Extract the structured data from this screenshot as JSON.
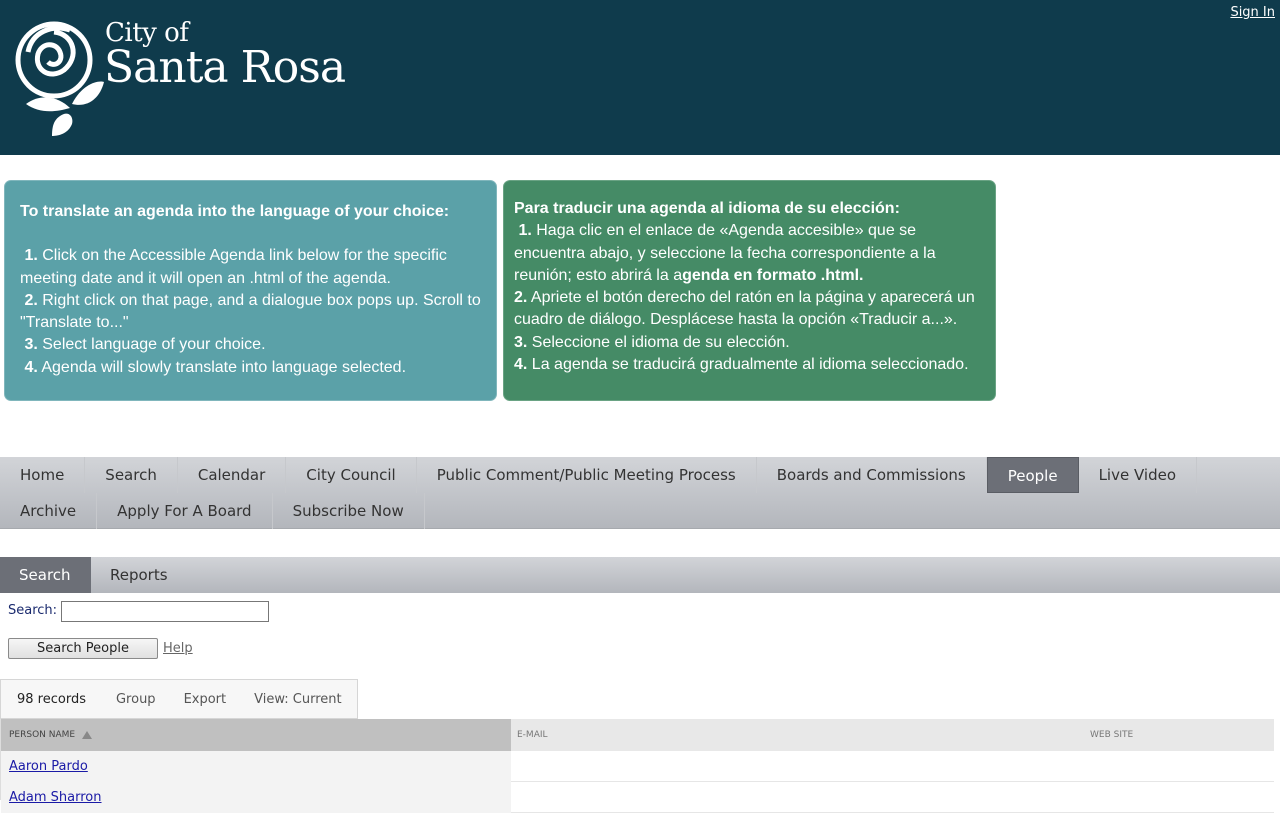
{
  "header": {
    "logo_city": "City of",
    "logo_name": "Santa Rosa",
    "sign_in": "Sign In"
  },
  "panel_en": {
    "title": "To translate an agenda into the language of your choice:",
    "steps": [
      {
        "num": "1.",
        "text": "Click on the Accessible Agenda link below for the specific meeting date and it will open an .html of the agenda."
      },
      {
        "num": "2.",
        "text": "Right click on that page, and a dialogue box pops up. Scroll to \"Translate to...\""
      },
      {
        "num": "3.",
        "text": "Select language of your choice."
      },
      {
        "num": "4.",
        "text": "Agenda will slowly translate into language selected."
      }
    ]
  },
  "panel_es": {
    "title": "Para traducir una agenda al idioma de su elección:",
    "steps": [
      {
        "num": "1.",
        "text": "Haga clic en el enlace de «Agenda accesible» que se encuentra abajo, y seleccione la fecha correspondiente a la reunión; esto abrirá la a",
        "bold_tail": "genda en formato .html."
      },
      {
        "num": "2.",
        "text": "Apriete el botón derecho del ratón en la página y aparecerá un cuadro de diálogo. Desplácese hasta la opción «Traducir a...»."
      },
      {
        "num": "3.",
        "text": "Seleccione el idioma de su elección."
      },
      {
        "num": "4.",
        "text": "La agenda se traducirá gradualmente al idioma seleccionado."
      }
    ]
  },
  "mainnav": {
    "row1": [
      "Home",
      "Search",
      "Calendar",
      "City Council",
      "Public Comment/Public Meeting Process",
      "Boards and Commissions",
      "People",
      "Live Video"
    ],
    "row2": [
      "Archive",
      "Apply For A Board",
      "Subscribe Now"
    ],
    "active": "People"
  },
  "subnav": {
    "items": [
      "Search",
      "Reports"
    ],
    "active": "Search"
  },
  "search": {
    "label": "Search:",
    "value": "",
    "button": "Search People",
    "help": "Help"
  },
  "toolbar": {
    "records": "98 records",
    "group": "Group",
    "export": "Export",
    "view": "View: Current"
  },
  "grid": {
    "columns": [
      "PERSON NAME",
      "E-MAIL",
      "WEB SITE"
    ],
    "rows": [
      {
        "name": "Aaron Pardo",
        "email": "",
        "web": ""
      },
      {
        "name": "Adam Sharron",
        "email": "",
        "web": ""
      }
    ]
  }
}
